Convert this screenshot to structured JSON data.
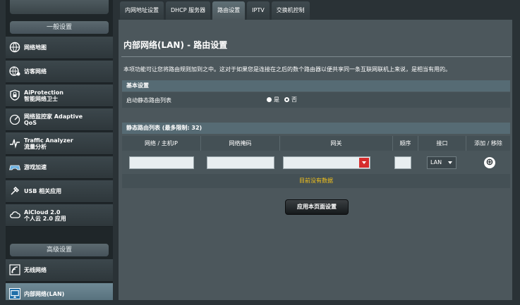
{
  "sidebar": {
    "general_header": "一般设置",
    "advanced_header": "高级设置",
    "items": [
      {
        "label": "网络地图"
      },
      {
        "label": "访客网络"
      },
      {
        "label": "AiProtection\n智能网络卫士"
      },
      {
        "label": "网络监控家 Adaptive\nQoS"
      },
      {
        "label": "Traffic Analyzer\n流量分析"
      },
      {
        "label": "游戏加速"
      },
      {
        "label": "USB 相关应用"
      },
      {
        "label": "AiCloud 2.0\n个人云 2.0 应用"
      }
    ],
    "adv_items": [
      {
        "label": "无线网络"
      },
      {
        "label": "内部网络(LAN)"
      }
    ]
  },
  "tabs": [
    "内网地址设置",
    "DHCP 服务器",
    "路由设置",
    "IPTV",
    "交换机控制"
  ],
  "page": {
    "title": "内部网络(LAN) - 路由设置",
    "description": "本项功能可让您将路由规则加到之中。这对于如果您是连接在之后的数个路由器以便共享同一条互联网联机上来说，是相当有用的。"
  },
  "basic": {
    "header": "基本设置",
    "label": "启动静态路由列表",
    "yes": "是",
    "no": "否"
  },
  "static_list": {
    "header": "静态路由列表 (最多限制: 32)",
    "columns": [
      "网络 / 主机IP",
      "网络掩码",
      "网关",
      "顺序",
      "接口",
      "添加 / 移除"
    ],
    "interface_value": "LAN",
    "empty_text": "目前没有数据"
  },
  "apply_label": "应用本页面设置"
}
